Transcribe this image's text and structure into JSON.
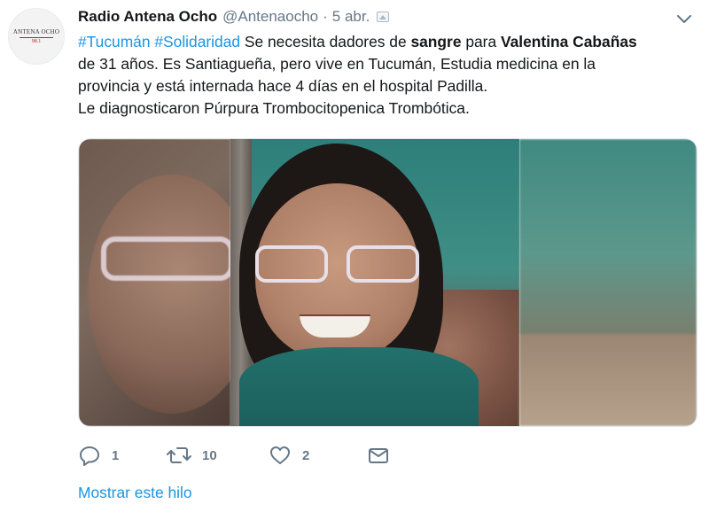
{
  "tweet": {
    "avatar": {
      "line1": "ANTENA OCHO",
      "line2": "98.1"
    },
    "author_name": "Radio Antena Ocho",
    "handle": "@Antenaocho",
    "separator": "·",
    "time": "5 abr.",
    "text": {
      "hashtag1": "#Tucumán",
      "hashtag2": "#Solidaridad",
      "part1": " Se necesita dadores de ",
      "bold1": "sangre",
      "part2": " para ",
      "bold2": "Valentina Cabañas",
      "line2": "de 31 años. Es Santiagueña, pero vive en Tucumán, Estudia medicina en la",
      "line3": "provincia y está internada hace 4 días en el hospital Padilla.",
      "line4": "Le diagnosticaron Púrpura Trombocitopenica  Trombótica."
    },
    "actions": {
      "reply_count": "1",
      "retweet_count": "10",
      "like_count": "2"
    },
    "show_thread": "Mostrar este hilo"
  },
  "colors": {
    "link": "#1b95e0",
    "muted": "#657786",
    "text": "#14171a"
  },
  "icons": [
    "chevron-down-icon",
    "media-icon",
    "reply-icon",
    "retweet-icon",
    "heart-icon",
    "direct-message-icon"
  ]
}
